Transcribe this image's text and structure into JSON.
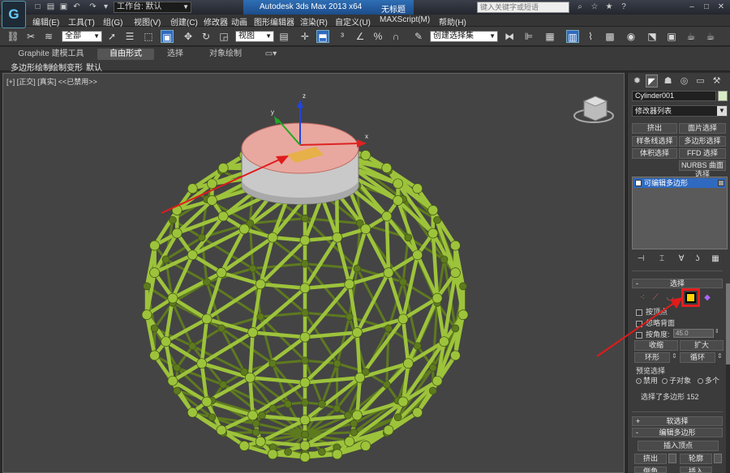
{
  "titlebar": {
    "logo": "G",
    "workspace": "工作台: 默认",
    "app_title": "Autodesk 3ds Max  2013 x64",
    "doc_title": "无标题",
    "search_placeholder": "键入关键字或短语"
  },
  "menu": [
    "编辑(E)",
    "工具(T)",
    "组(G)",
    "视图(V)",
    "创建(C)",
    "修改器",
    "动画",
    "图形编辑器",
    "渲染(R)",
    "自定义(U)",
    "MAXScript(M)",
    "帮助(H)"
  ],
  "toolbar": {
    "filter": "全部",
    "ref_coord": "视图",
    "named_selection": "创建选择集"
  },
  "ribbon": {
    "tabs": [
      "Graphite 建模工具",
      "自由形式",
      "选择",
      "对象绘制"
    ],
    "subitems": [
      "多边形绘制",
      "绘制变形",
      "默认"
    ]
  },
  "viewport": {
    "label": "[+] [正交] [真实] <<已禁用>>",
    "axes": {
      "x": "x",
      "y": "y",
      "z": "z"
    },
    "colors": {
      "wire": "#9dc33b",
      "wire_dark": "#5e7a1f",
      "cylinder_top": "#e8a8a0",
      "cylinder_side": "#cfcfcf",
      "arrow": "#e11b1b",
      "background": "#444444"
    }
  },
  "panel": {
    "object_name": "Cylinder001",
    "modifier_list": "修改器列表",
    "buttons": [
      "挤出",
      "面片选择",
      "样条线选择",
      "多边形选择",
      "体积选择",
      "FFD 选择",
      "NURBS 曲面选择"
    ],
    "stack_item": "可编辑多边形",
    "selection_rollout": {
      "title": "选择",
      "by_vertex": "按顶点",
      "ignore_backfacing": "忽略背面",
      "by_angle": "按角度:",
      "angle_value": "45.0",
      "shrink": "收缩",
      "grow": "扩大",
      "ring": "环形",
      "loop": "循环",
      "preview_title": "预览选择",
      "preview_options": [
        "禁用",
        "子对象",
        "多个"
      ],
      "status": "选择了多边形 152"
    },
    "soft_selection": "软选择",
    "edit_poly_title": "编辑多边形",
    "insert_vertex": "插入顶点",
    "extrude": "挤出",
    "outline": "轮廓",
    "bevel": "倒角",
    "inset": "插入"
  }
}
